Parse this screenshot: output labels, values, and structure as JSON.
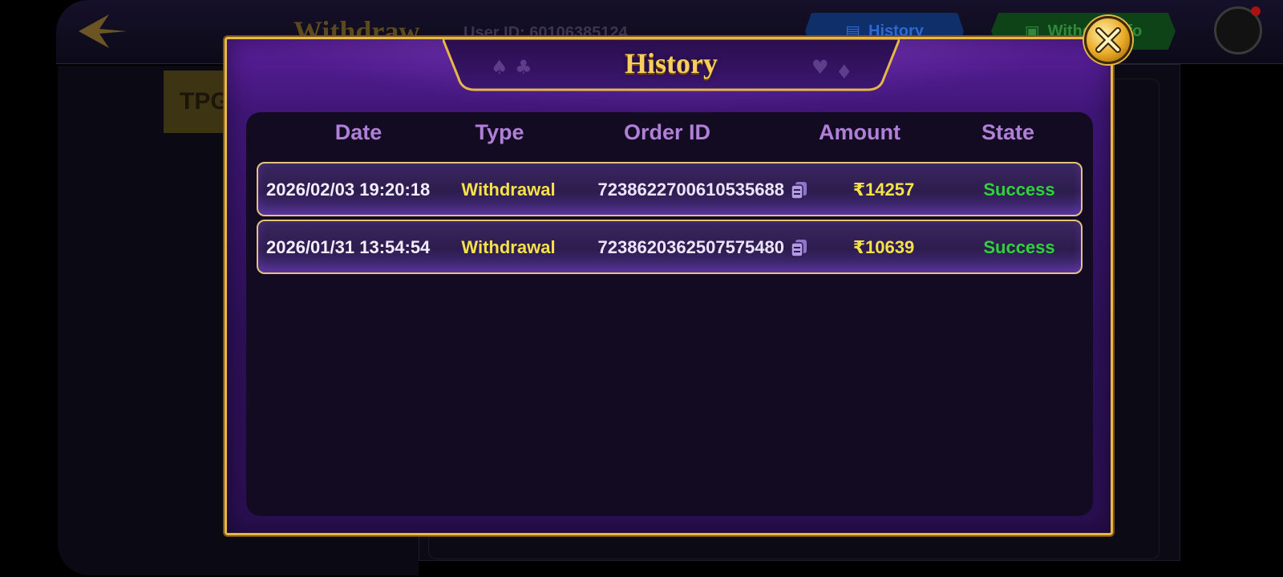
{
  "background": {
    "title": "Withdraw",
    "user_id": "User ID: 60106385124",
    "tab_history": "History",
    "tab_info": "Withd… Info",
    "tpg_label": "TPG"
  },
  "modal": {
    "title": "History",
    "close_label": "close"
  },
  "table": {
    "headers": {
      "date": "Date",
      "type": "Type",
      "order_id": "Order ID",
      "amount": "Amount",
      "state": "State"
    },
    "rows": [
      {
        "date": "2026/02/03 19:20:18",
        "type": "Withdrawal",
        "order_id": "7238622700610535688",
        "amount": "₹14257",
        "state": "Success"
      },
      {
        "date": "2026/01/31 13:54:54",
        "type": "Withdrawal",
        "order_id": "7238620362507575480",
        "amount": "₹10639",
        "state": "Success"
      }
    ]
  },
  "colors": {
    "gold": "#e7b748",
    "purple": "#3f1677",
    "header_text": "#b07fd8",
    "yellow_text": "#f5e14a",
    "success_green": "#2fd23a"
  }
}
